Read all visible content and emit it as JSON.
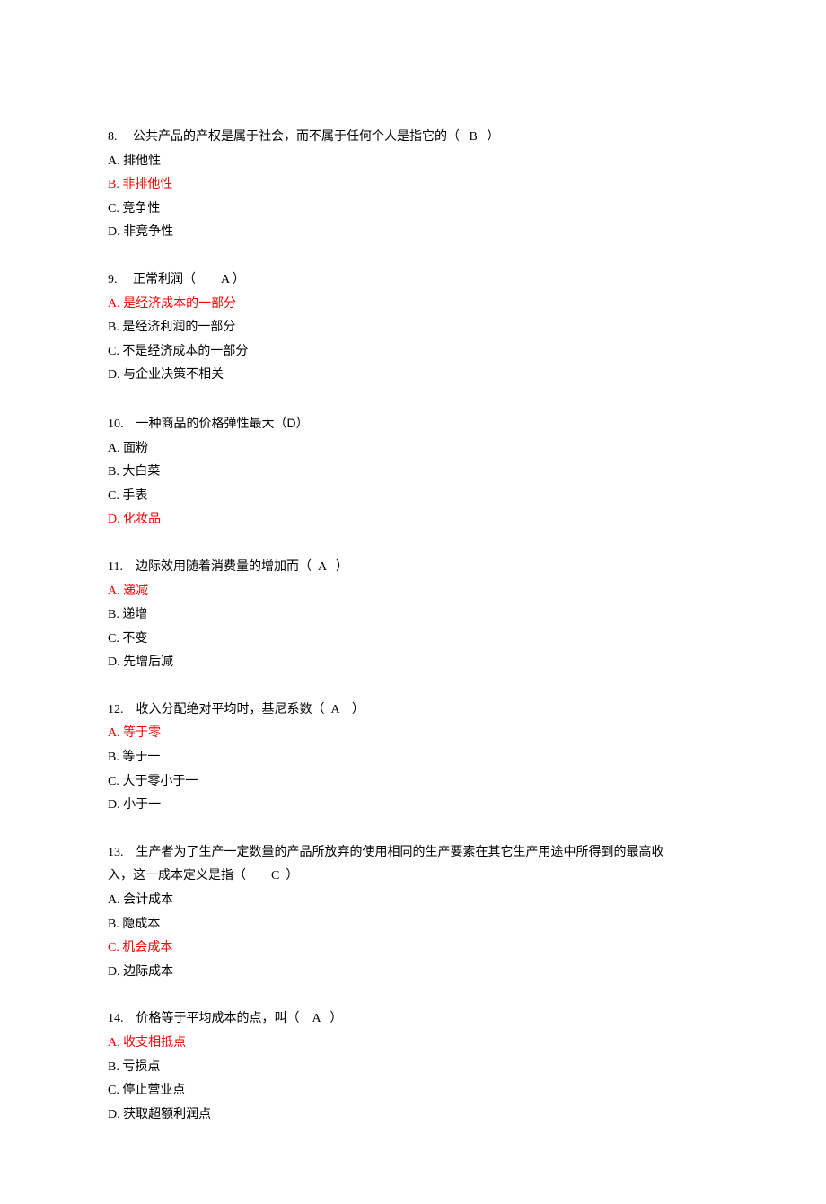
{
  "questions": [
    {
      "num": "8.",
      "stem_pre": "公共产品的产权是属于社会，而不属于任何个人是指它的（",
      "answer_in_paren": "B",
      "stem_post": "）",
      "options": [
        {
          "label": "A.",
          "text": "排他性",
          "correct": false
        },
        {
          "label": "B.",
          "text": "非排他性",
          "correct": true
        },
        {
          "label": "C.",
          "text": "竞争性",
          "correct": false
        },
        {
          "label": "D.",
          "text": "非竞争性",
          "correct": false
        }
      ]
    },
    {
      "num": "9.",
      "stem_pre": "正常利润（",
      "answer_in_paren": "A",
      "stem_post": "）",
      "options": [
        {
          "label": "A.",
          "text": "是经济成本的一部分",
          "correct": true
        },
        {
          "label": "B.",
          "text": "是经济利润的一部分",
          "correct": false
        },
        {
          "label": "C.",
          "text": "不是经济成本的一部分",
          "correct": false
        },
        {
          "label": "D.",
          "text": "与企业决策不相关",
          "correct": false
        }
      ]
    },
    {
      "num": "10.",
      "stem_pre": "一种商品的价格弹性最大（",
      "answer_in_paren": "D",
      "stem_post": "）",
      "answer_alt_font": true,
      "tight_paren": true,
      "options": [
        {
          "label": "A.",
          "text": "面粉",
          "correct": false
        },
        {
          "label": "B.",
          "text": "大白菜",
          "correct": false
        },
        {
          "label": "C.",
          "text": "手表",
          "correct": false
        },
        {
          "label": "D.",
          "text": "化妆品",
          "correct": true
        }
      ]
    },
    {
      "num": "11.",
      "stem_pre": "边际效用随着消费量的增加而（",
      "answer_in_paren": "A",
      "stem_post": "）",
      "options": [
        {
          "label": "A.",
          "text": "递减",
          "correct": true
        },
        {
          "label": "B.",
          "text": "递增",
          "correct": false
        },
        {
          "label": "C.",
          "text": "不变",
          "correct": false
        },
        {
          "label": "D.",
          "text": "先增后减",
          "correct": false
        }
      ]
    },
    {
      "num": "12.",
      "stem_pre": "收入分配绝对平均时，基尼系数（",
      "answer_in_paren": "A",
      "stem_post": "）",
      "options": [
        {
          "label": "A.",
          "text": "等于零",
          "correct": true
        },
        {
          "label": "B.",
          "text": "等于一",
          "correct": false
        },
        {
          "label": "C.",
          "text": "大于零小于一",
          "correct": false
        },
        {
          "label": "D.",
          "text": "小于一",
          "correct": false
        }
      ]
    },
    {
      "num": "13.",
      "stem_pre": "生产者为了生产一定数量的产品所放弃的使用相同的生产要素在其它生产用途中所得到的最高收",
      "stem_line2_pre": "入，这一成本定义是指（",
      "answer_in_paren": "C",
      "stem_post": "）",
      "wrap": true,
      "options": [
        {
          "label": "A.",
          "text": "会计成本",
          "correct": false
        },
        {
          "label": "B.",
          "text": "隐成本",
          "correct": false
        },
        {
          "label": "C.",
          "text": "机会成本",
          "correct": true
        },
        {
          "label": "D.",
          "text": "边际成本",
          "correct": false
        }
      ]
    },
    {
      "num": "14.",
      "stem_pre": "价格等于平均成本的点，叫（",
      "answer_in_paren": "A",
      "stem_post": "）",
      "options": [
        {
          "label": "A.",
          "text": "收支相抵点",
          "correct": true
        },
        {
          "label": "B.",
          "text": "亏损点",
          "correct": false
        },
        {
          "label": "C.",
          "text": "停止营业点",
          "correct": false
        },
        {
          "label": "D.",
          "text": "获取超额利润点",
          "correct": false
        }
      ]
    }
  ]
}
